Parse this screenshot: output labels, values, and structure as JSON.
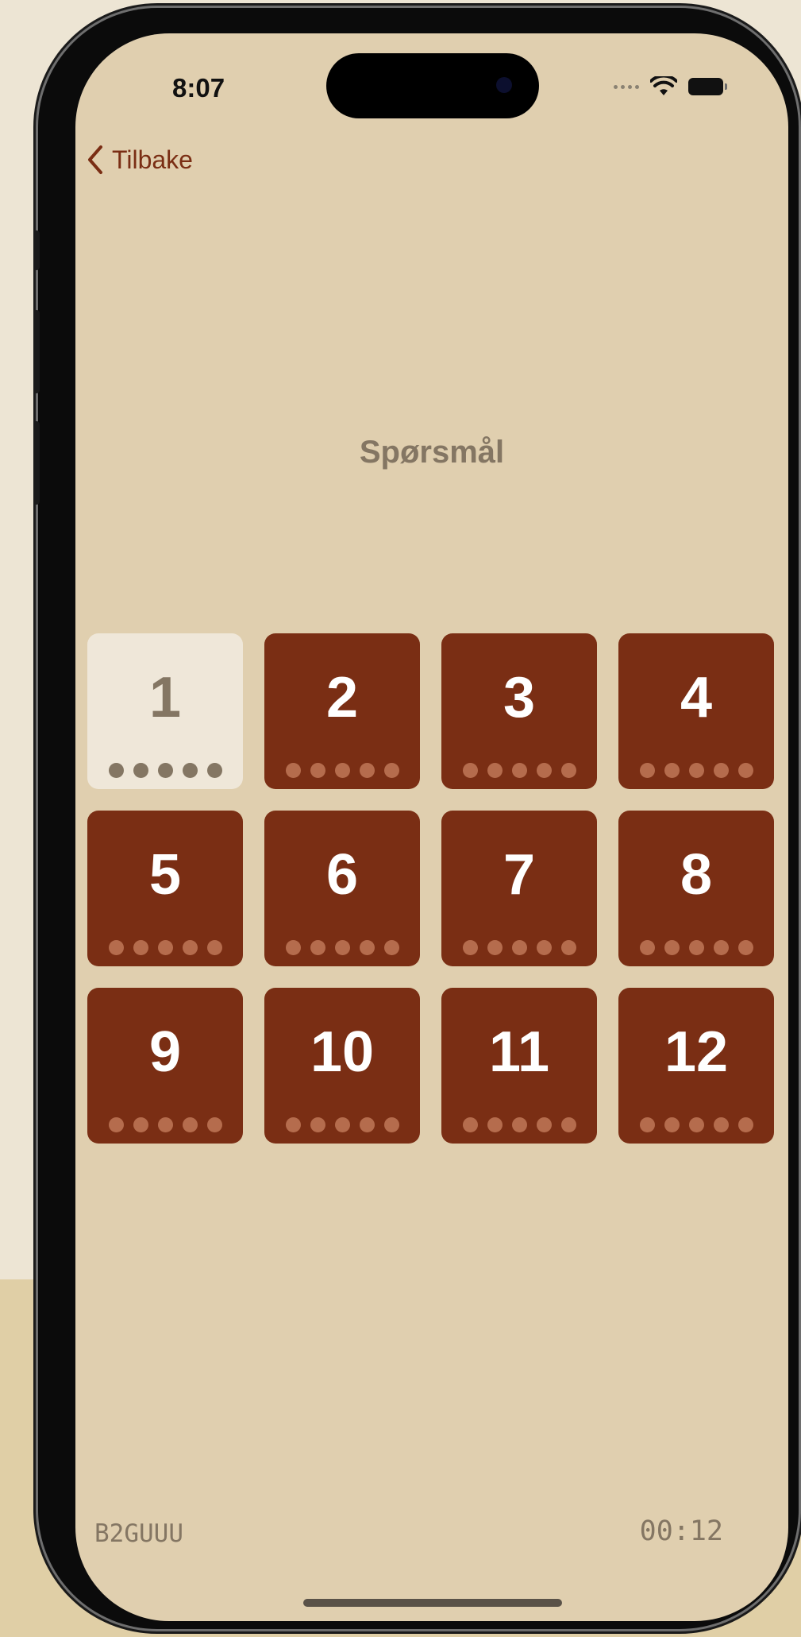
{
  "status_bar": {
    "time": "8:07"
  },
  "nav": {
    "back_label": "Tilbake"
  },
  "page": {
    "title": "Spørsmål"
  },
  "questions": {
    "active_index": 0,
    "dots_per_tile": 5,
    "items": [
      {
        "label": "1"
      },
      {
        "label": "2"
      },
      {
        "label": "3"
      },
      {
        "label": "4"
      },
      {
        "label": "5"
      },
      {
        "label": "6"
      },
      {
        "label": "7"
      },
      {
        "label": "8"
      },
      {
        "label": "9"
      },
      {
        "label": "10"
      },
      {
        "label": "11"
      },
      {
        "label": "12"
      }
    ]
  },
  "footer": {
    "code": "B2GUUU",
    "timer": "00:12"
  },
  "colors": {
    "background": "#e0cfaf",
    "accent": "#7a2e14",
    "active_tile": "#efe7d9",
    "muted_text": "#847663"
  },
  "icons": {
    "back": "chevron-left-icon",
    "wifi": "wifi-icon",
    "battery": "battery-icon",
    "signal": "signal-dots-icon"
  }
}
